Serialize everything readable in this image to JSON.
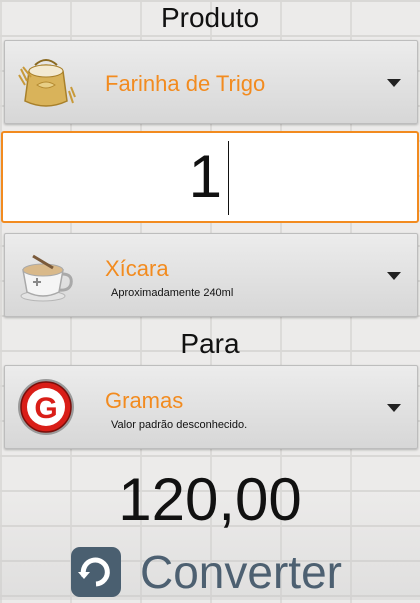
{
  "labels": {
    "produto": "Produto",
    "para": "Para"
  },
  "product_selector": {
    "title": "Farinha de Trigo",
    "icon": "flour-sack-icon"
  },
  "quantity_input": {
    "value": "1"
  },
  "from_unit_selector": {
    "title": "Xícara",
    "subtitle": "Aproximadamente 240ml",
    "icon": "cup-icon"
  },
  "to_unit_selector": {
    "title": "Gramas",
    "subtitle": "Valor padrão desconhecido.",
    "icon": "grams-g-icon",
    "icon_letter": "G"
  },
  "result": {
    "value": "120,00"
  },
  "convert_button": {
    "label": "Converter",
    "icon": "refresh-icon"
  },
  "colors": {
    "accent": "#f28b1f",
    "text": "#111111",
    "button_text": "#4d6071"
  }
}
